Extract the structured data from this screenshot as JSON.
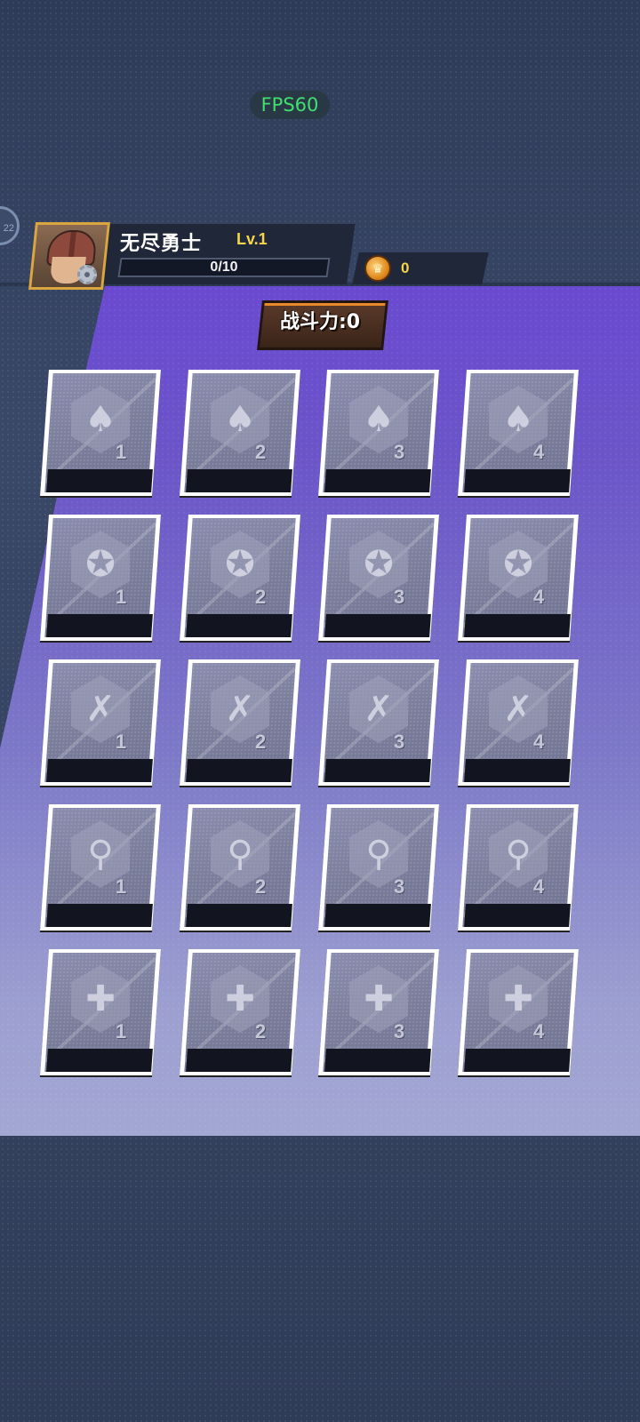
{
  "hud": {
    "fps": "FPS60",
    "side_badge": "22"
  },
  "player": {
    "name": "无尽勇士",
    "level": "Lv.1",
    "xp": "0/10"
  },
  "currency": {
    "coins": "0"
  },
  "board": {
    "power_label": "战斗力:0"
  },
  "colors": {
    "board_top": "#6a4ad0",
    "board_bottom": "#a3a7d3",
    "level_text": "#f5d64a",
    "fps_text": "#40e070"
  },
  "equipment_rows": [
    {
      "type": "weapon",
      "icon": "sword-icon",
      "glyph": "♠",
      "slots": [
        "1",
        "2",
        "3",
        "4"
      ]
    },
    {
      "type": "armor",
      "icon": "shuriken-icon",
      "glyph": "✪",
      "slots": [
        "1",
        "2",
        "3",
        "4"
      ]
    },
    {
      "type": "bow",
      "icon": "crossbow-icon",
      "glyph": "✗",
      "slots": [
        "1",
        "2",
        "3",
        "4"
      ]
    },
    {
      "type": "accessory",
      "icon": "ring-icon",
      "glyph": "⚲",
      "slots": [
        "1",
        "2",
        "3",
        "4"
      ]
    },
    {
      "type": "shield",
      "icon": "shield-cross-icon",
      "glyph": "✚",
      "slots": [
        "1",
        "2",
        "3",
        "4"
      ]
    }
  ]
}
